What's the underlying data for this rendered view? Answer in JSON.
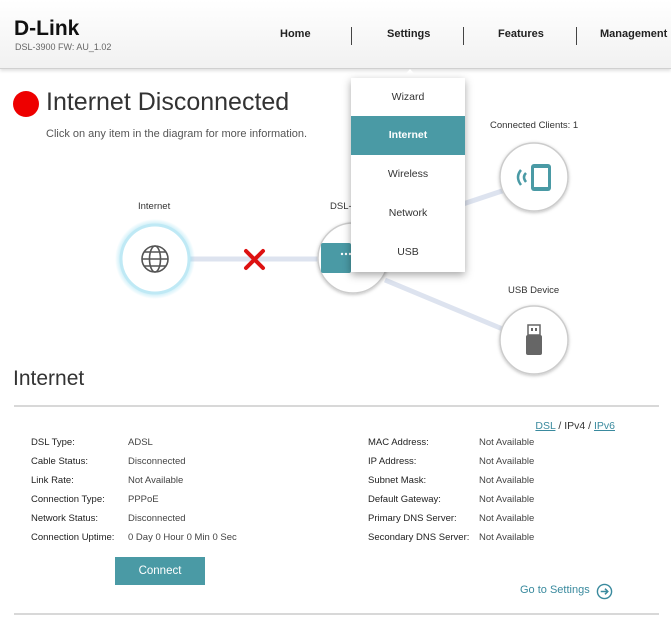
{
  "header": {
    "logo": "D-Link",
    "model": "DSL-3900   FW: AU_1.02",
    "nav": [
      {
        "label": "Home"
      },
      {
        "label": "Settings"
      },
      {
        "label": "Features"
      },
      {
        "label": "Management"
      }
    ]
  },
  "settings_menu": {
    "items": [
      {
        "label": "Wizard"
      },
      {
        "label": "Internet"
      },
      {
        "label": "Wireless"
      },
      {
        "label": "Network"
      },
      {
        "label": "USB"
      }
    ],
    "active": "Internet"
  },
  "status": {
    "title": "Internet Disconnected",
    "hint": "Click on any item in the diagram for more information.",
    "color": "#ee0000"
  },
  "diagram": {
    "internet_label": "Internet",
    "router_label": "DSL-",
    "clients_label": "Connected Clients: 1",
    "usb_label": "USB Device"
  },
  "internet": {
    "title": "Internet",
    "protocols": {
      "dsl": "DSL",
      "ipv4": "IPv4",
      "ipv6": "IPv6"
    },
    "left": [
      {
        "label": "DSL Type:",
        "value": "ADSL"
      },
      {
        "label": "Cable Status:",
        "value": "Disconnected"
      },
      {
        "label": "Link Rate:",
        "value": "Not Available"
      },
      {
        "label": "Connection Type:",
        "value": "PPPoE"
      },
      {
        "label": "Network Status:",
        "value": "Disconnected"
      },
      {
        "label": "Connection Uptime:",
        "value": "0 Day 0 Hour 0 Min 0 Sec"
      }
    ],
    "right": [
      {
        "label": "MAC Address:",
        "value": "Not Available"
      },
      {
        "label": "IP Address:",
        "value": "Not Available"
      },
      {
        "label": "Subnet Mask:",
        "value": "Not Available"
      },
      {
        "label": "Default Gateway:",
        "value": "Not Available"
      },
      {
        "label": "Primary DNS Server:",
        "value": "Not Available"
      },
      {
        "label": "Secondary DNS Server:",
        "value": "Not Available"
      }
    ],
    "connect_label": "Connect",
    "goto_label": "Go to Settings"
  },
  "colors": {
    "accent": "#4a9aa5",
    "link": "#3a8a9e",
    "error": "#dd1111"
  }
}
